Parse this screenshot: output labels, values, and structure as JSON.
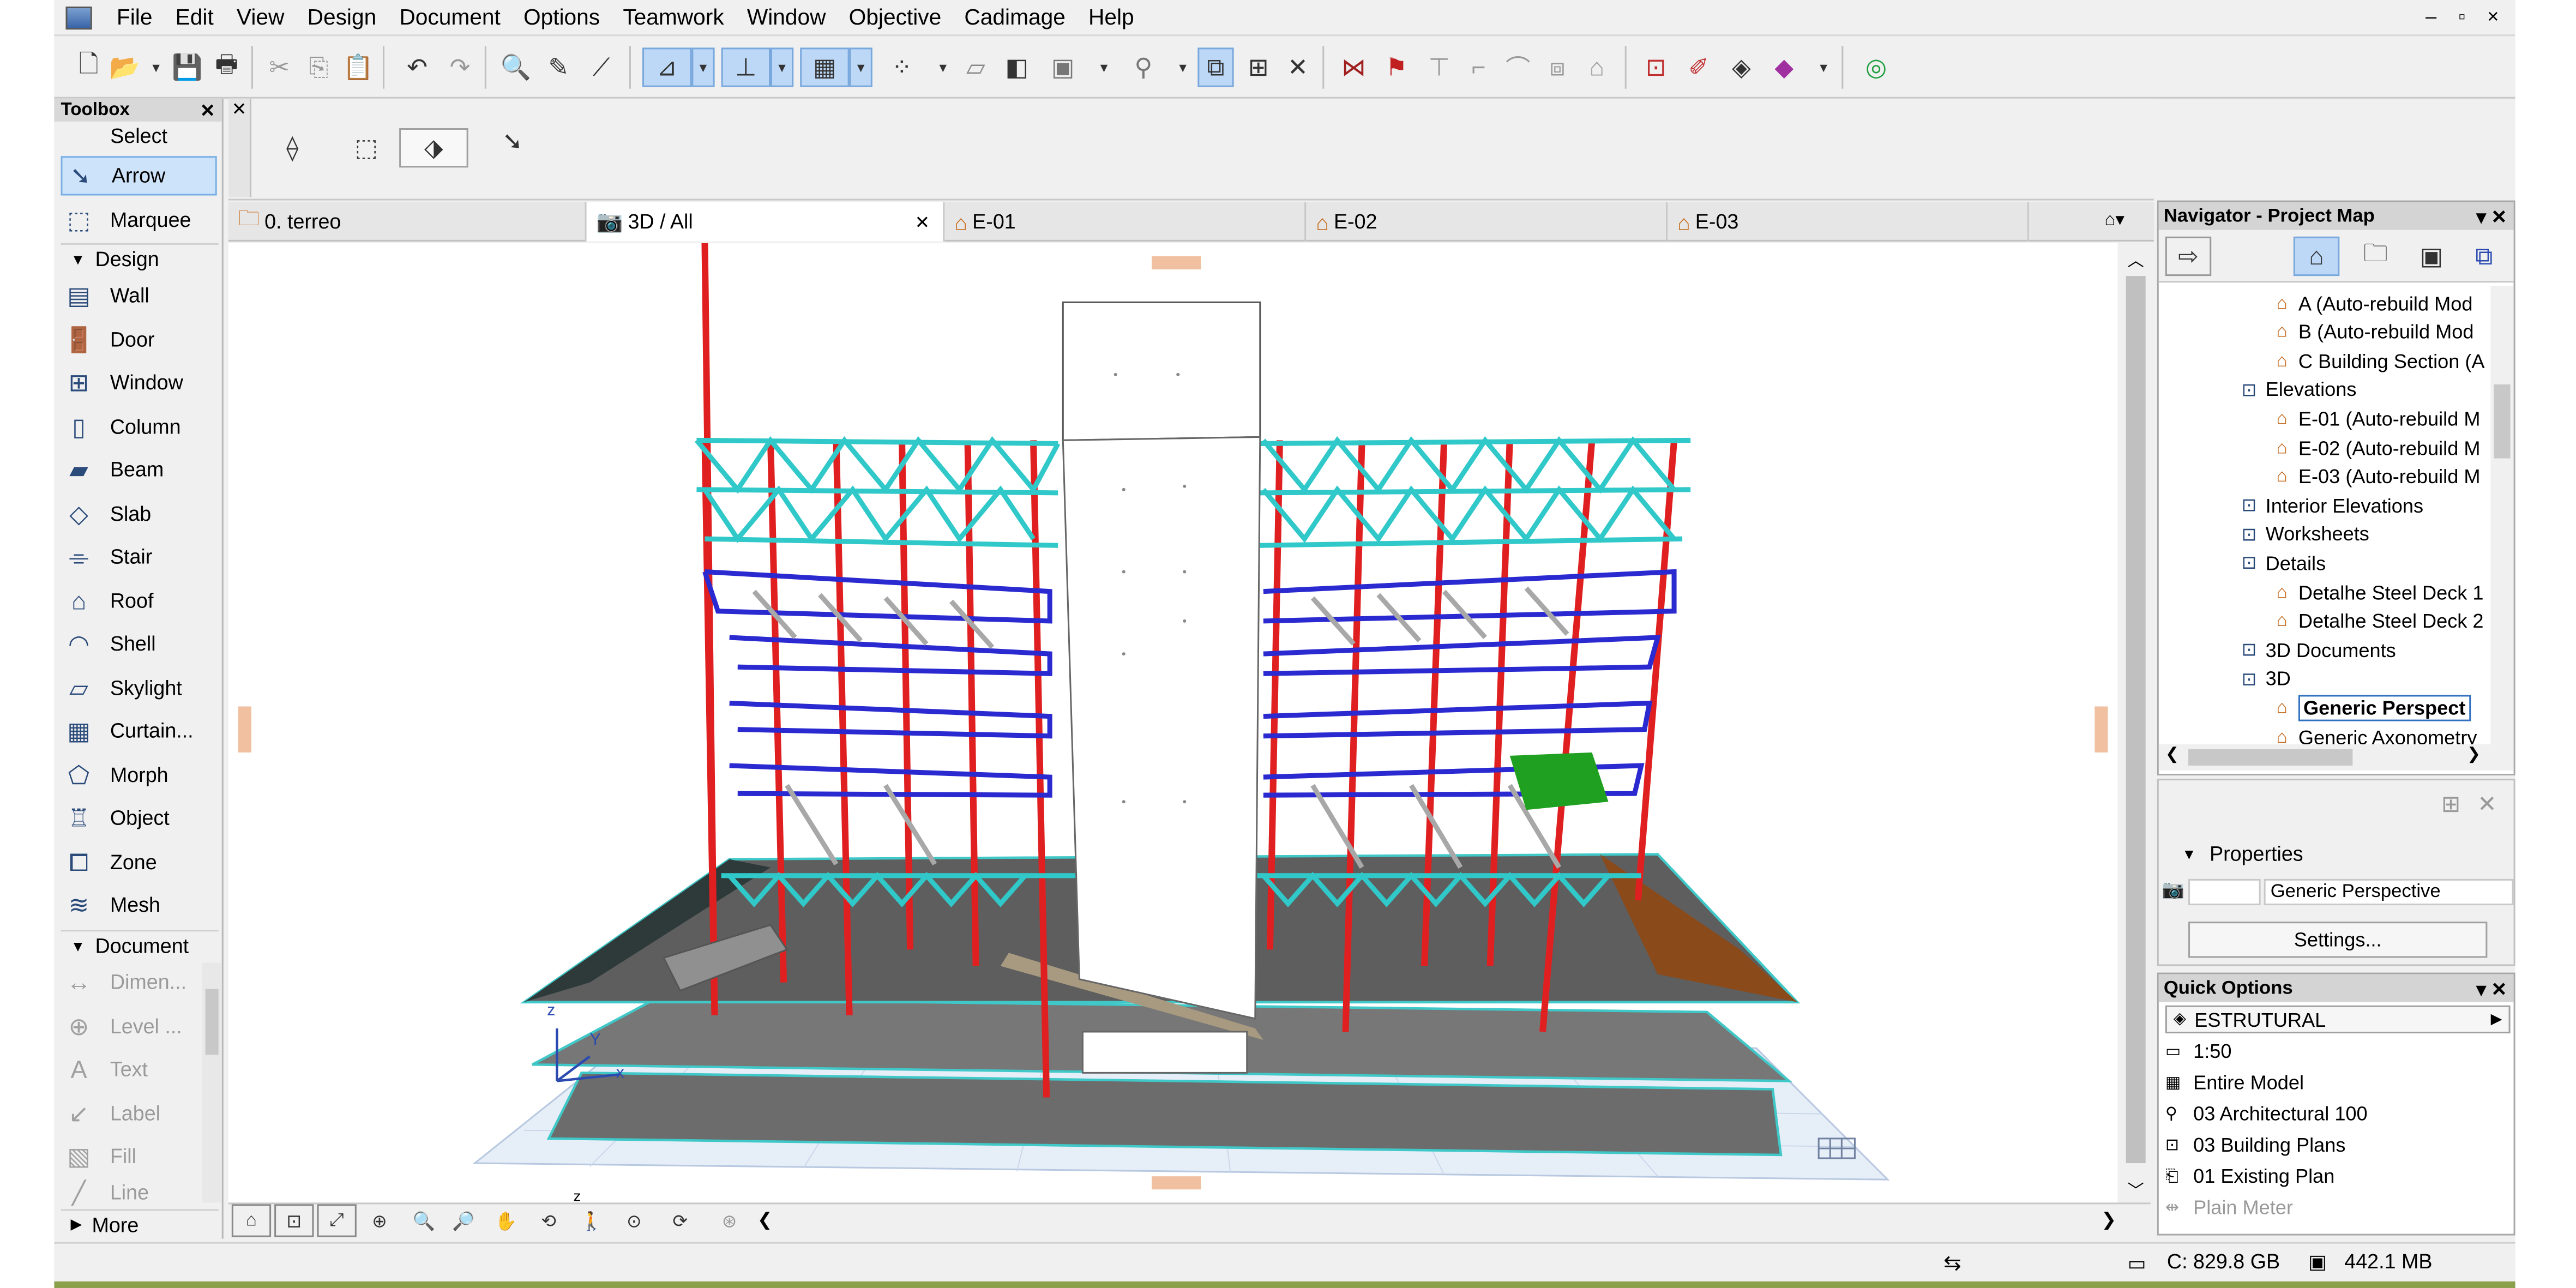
{
  "menu": {
    "items": [
      "File",
      "Edit",
      "View",
      "Design",
      "Document",
      "Options",
      "Teamwork",
      "Window",
      "Objective",
      "Cadimage",
      "Help"
    ],
    "window_controls": "– ▫ ×"
  },
  "toolbox": {
    "title": "Toolbox",
    "select_label": "Select",
    "arrow_label": "Arrow",
    "marquee_label": "Marquee",
    "design_group": "Design",
    "design_tools": [
      "Wall",
      "Door",
      "Window",
      "Column",
      "Beam",
      "Slab",
      "Stair",
      "Roof",
      "Shell",
      "Skylight",
      "Curtain...",
      "Morph",
      "Object",
      "Zone",
      "Mesh"
    ],
    "document_group": "Document",
    "document_tools": [
      "Dimen...",
      "Level ...",
      "Text",
      "Label",
      "Fill",
      "Line"
    ],
    "more_label": "More"
  },
  "tabs": [
    {
      "label": "0. terreo",
      "icon": "folder-icon"
    },
    {
      "label": "3D / All",
      "icon": "camera-icon",
      "active": true
    },
    {
      "label": "E-01",
      "icon": "elevation-icon"
    },
    {
      "label": "E-02",
      "icon": "elevation-icon"
    },
    {
      "label": "E-03",
      "icon": "elevation-icon"
    }
  ],
  "navigator": {
    "title": "Navigator - Project Map",
    "tree": [
      {
        "label": "A (Auto-rebuild Mod",
        "indent": 3
      },
      {
        "label": "B (Auto-rebuild Mod",
        "indent": 3
      },
      {
        "label": "C Building Section (A",
        "indent": 3
      },
      {
        "label": "Elevations",
        "indent": 2
      },
      {
        "label": "E-01 (Auto-rebuild M",
        "indent": 3
      },
      {
        "label": "E-02 (Auto-rebuild M",
        "indent": 3
      },
      {
        "label": "E-03 (Auto-rebuild M",
        "indent": 3
      },
      {
        "label": "Interior Elevations",
        "indent": 2
      },
      {
        "label": "Worksheets",
        "indent": 2
      },
      {
        "label": "Details",
        "indent": 2
      },
      {
        "label": "Detalhe Steel Deck 1",
        "indent": 3
      },
      {
        "label": "Detalhe Steel Deck 2",
        "indent": 3
      },
      {
        "label": "3D Documents",
        "indent": 2
      },
      {
        "label": "3D",
        "indent": 2
      },
      {
        "label": "Generic Perspect",
        "indent": 3,
        "selected": true
      },
      {
        "label": "Generic Axonometry",
        "indent": 3
      }
    ]
  },
  "properties": {
    "header": "Properties",
    "value": "Generic Perspective",
    "settings_button": "Settings..."
  },
  "quick_options": {
    "title": "Quick Options",
    "layer_combo": "ESTRUTURAL",
    "rows": [
      "1:50",
      "Entire Model",
      "03 Architectural 100",
      "03 Building Plans",
      "01 Existing Plan",
      "Plain Meter"
    ]
  },
  "status": {
    "disk": "C: 829.8 GB",
    "memory": "442.1 MB"
  },
  "axis": {
    "z": "z",
    "y": "Y",
    "x": "x",
    "z2": "z"
  },
  "colors": {
    "steel_column": "#e02020",
    "truss": "#30c8c8",
    "beam": "#2a2ad0",
    "slab": "#6c6c6c",
    "accent_green": "#20a020",
    "accent_brown": "#8a4a1a",
    "selection": "#cde3f9"
  }
}
